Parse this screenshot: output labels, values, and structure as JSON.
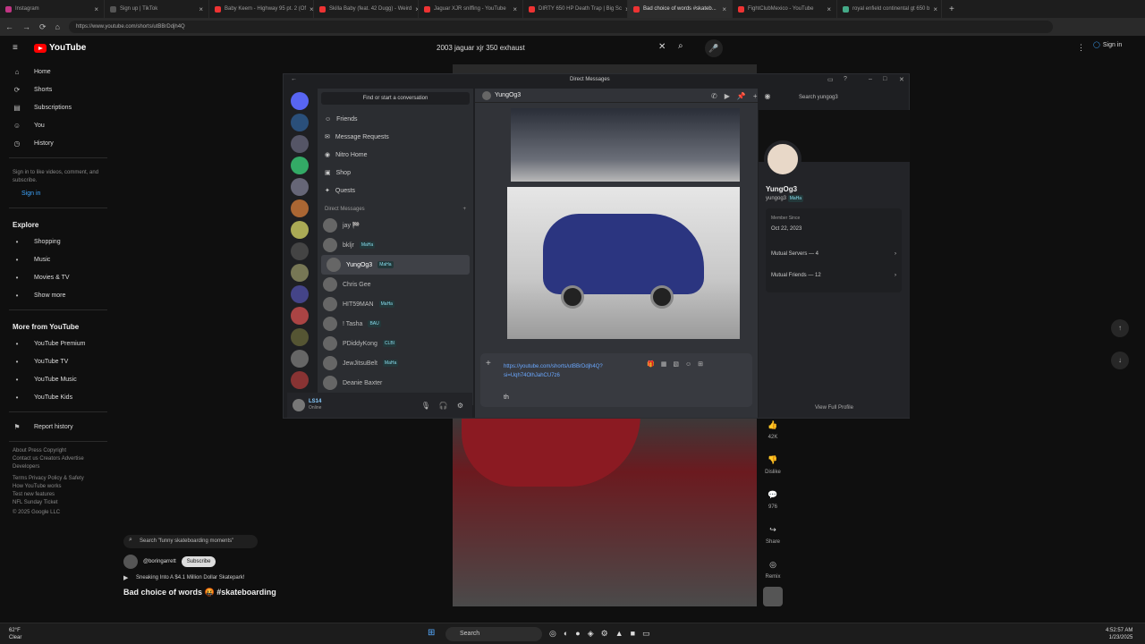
{
  "browser": {
    "tabs": [
      {
        "label": "Instagram",
        "color": "#c13584"
      },
      {
        "label": "Sign up | TikTok",
        "color": "#555"
      },
      {
        "label": "Baby Keem - Highway 95 pt. 2 (Of",
        "color": "#e33"
      },
      {
        "label": "Skilla Baby (feat. 42 Dugg) - Weird",
        "color": "#e33"
      },
      {
        "label": "Jaguar XJR sniffing - YouTube",
        "color": "#e33"
      },
      {
        "label": "DIRTY 650 HP Death Trap | Big Sc",
        "color": "#e33"
      },
      {
        "label": "Bad choice of words #skateb...",
        "color": "#e33",
        "active": true
      },
      {
        "label": "FightClubMexico - YouTube",
        "color": "#e33"
      },
      {
        "label": "royal enfield continental gt 650 b",
        "color": "#4a8"
      }
    ],
    "url": "https://www.youtube.com/shorts/utBBrDdjh4Q",
    "profile_label": "InPrivate"
  },
  "yt": {
    "logo": "YouTube",
    "search_query": "2003 jaguar xjr 350 exhaust",
    "signin": "Sign in",
    "nav": [
      {
        "label": "Home",
        "icon": "⌂"
      },
      {
        "label": "Shorts",
        "icon": "⟳"
      },
      {
        "label": "Subscriptions",
        "icon": "▤"
      },
      {
        "label": "You",
        "icon": "☺"
      },
      {
        "label": "History",
        "icon": "◷"
      }
    ],
    "signin_prompt": "Sign in to like videos, comment, and subscribe.",
    "signin_btn": "Sign in",
    "explore_title": "Explore",
    "explore": [
      {
        "label": "Shopping"
      },
      {
        "label": "Music"
      },
      {
        "label": "Movies & TV"
      },
      {
        "label": "Show more"
      }
    ],
    "more_title": "More from YouTube",
    "more": [
      {
        "label": "YouTube Premium"
      },
      {
        "label": "YouTube TV"
      },
      {
        "label": "YouTube Music"
      },
      {
        "label": "YouTube Kids"
      }
    ],
    "report": "Report history",
    "footer1": "About  Press  Copyright\nContact us  Creators  Advertise\nDevelopers",
    "footer2": "Terms  Privacy  Policy & Safety\nHow YouTube works\nTest new features\nNFL Sunday Ticket",
    "copyright": "© 2025 Google LLC",
    "video_search": "Search \"funny skateboarding moments\"",
    "channel": "@boringarrett",
    "subscribe": "Subscribe",
    "linked_video": "Sneaking Into A $4.1 Million Dollar Skatepark!",
    "video_title": "Bad choice of words 🤬 #skateboarding",
    "actions": [
      {
        "icon": "👍",
        "label": "42K"
      },
      {
        "icon": "👎",
        "label": "Dislike"
      },
      {
        "icon": "💬",
        "label": "976"
      },
      {
        "icon": "↪",
        "label": "Share"
      },
      {
        "icon": "◎",
        "label": "Remix"
      }
    ]
  },
  "discord": {
    "title": "Direct Messages",
    "find": "Find or start a conversation",
    "nav": [
      {
        "label": "Friends",
        "icon": "☺"
      },
      {
        "label": "Message Requests",
        "icon": "✉"
      },
      {
        "label": "Nitro Home",
        "icon": "◉"
      },
      {
        "label": "Shop",
        "icon": "▣"
      },
      {
        "label": "Quests",
        "icon": "✦"
      }
    ],
    "dm_header": "Direct Messages",
    "dms": [
      {
        "name": "jay 🏁",
        "tag": ""
      },
      {
        "name": "bkljr",
        "tag": "MaHa"
      },
      {
        "name": "YungOg3",
        "tag": "MaHa",
        "selected": true
      },
      {
        "name": "Chris Gee",
        "tag": ""
      },
      {
        "name": "HIT59MAN",
        "tag": "MaHa"
      },
      {
        "name": "! Tasha",
        "tag": "BAU"
      },
      {
        "name": "PDiddyKong",
        "tag": "CLBI"
      },
      {
        "name": "JewJitsuBelt",
        "tag": "MaHa"
      },
      {
        "name": "Deanie Baxter",
        "tag": ""
      }
    ],
    "me_name": "LS14",
    "me_status": "Online",
    "chat_user": "YungOg3",
    "search_placeholder": "Search yungog3",
    "link": "https://youtube.com/shorts/utBBrDdjh4Q?si=Uqh74OlhJahCU7z6",
    "typed": "th",
    "profile": {
      "name": "YungOg3",
      "username": "yungog3",
      "tag": "MaHa",
      "member_label": "Member Since",
      "member_since": "Oct 22, 2023",
      "mutual_servers": "Mutual Servers — 4",
      "mutual_friends": "Mutual Friends — 12",
      "view_full": "View Full Profile"
    }
  },
  "taskbar": {
    "temp": "62°F",
    "cond": "Clear",
    "search": "Search",
    "time": "4:52:57 AM",
    "date": "1/23/2025"
  }
}
